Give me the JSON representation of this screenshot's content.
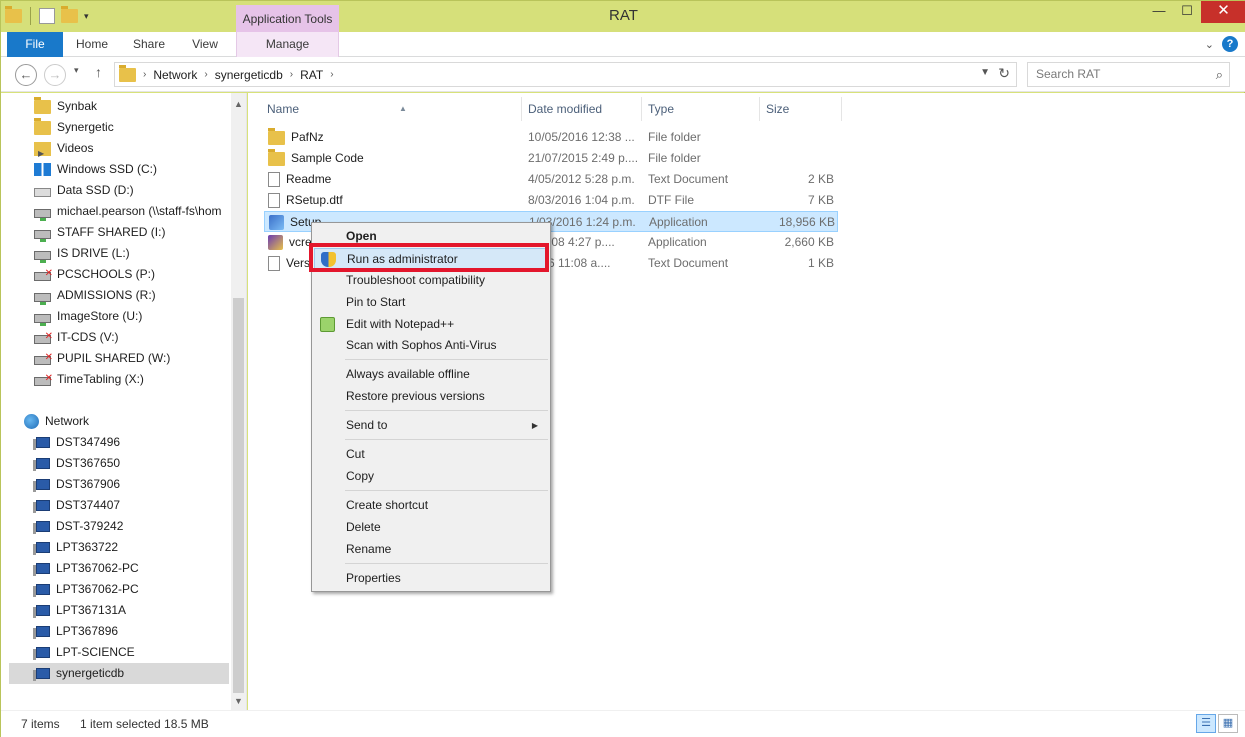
{
  "window": {
    "title": "RAT",
    "contextual_tab_group": "Application Tools",
    "controls": [
      "—",
      "☐",
      "✕"
    ]
  },
  "ribbon": {
    "tabs": [
      "File",
      "Home",
      "Share",
      "View",
      "Manage"
    ]
  },
  "address": {
    "breadcrumbs": [
      "Network",
      "synergeticdb",
      "RAT"
    ],
    "search_placeholder": "Search RAT"
  },
  "nav_pane": {
    "items": [
      {
        "label": "Synbak",
        "icon": "folder-icon"
      },
      {
        "label": "Synergetic",
        "icon": "folder-icon"
      },
      {
        "label": "Videos",
        "icon": "videos-icon"
      },
      {
        "label": "Windows SSD (C:)",
        "icon": "windows-drive-icon"
      },
      {
        "label": "Data SSD (D:)",
        "icon": "drive-icon"
      },
      {
        "label": "michael.pearson (\\\\staff-fs\\hom",
        "icon": "network-drive-icon"
      },
      {
        "label": "STAFF SHARED (I:)",
        "icon": "network-drive-icon"
      },
      {
        "label": "IS DRIVE (L:)",
        "icon": "network-drive-icon"
      },
      {
        "label": "PCSCHOOLS (P:)",
        "icon": "disconnected-drive-icon"
      },
      {
        "label": "ADMISSIONS (R:)",
        "icon": "network-drive-icon"
      },
      {
        "label": "ImageStore (U:)",
        "icon": "network-drive-icon"
      },
      {
        "label": "IT-CDS (V:)",
        "icon": "disconnected-drive-icon"
      },
      {
        "label": "PUPIL SHARED (W:)",
        "icon": "disconnected-drive-icon"
      },
      {
        "label": "TimeTabling (X:)",
        "icon": "disconnected-drive-icon"
      }
    ],
    "network_label": "Network",
    "computers": [
      "DST347496",
      "DST367650",
      "DST367906",
      "DST374407",
      "DST-379242",
      "LPT363722",
      "LPT367062-PC",
      "LPT367062-PC",
      "LPT367131A",
      "LPT367896",
      "LPT-SCIENCE",
      "synergeticdb"
    ]
  },
  "file_list": {
    "columns": [
      "Name",
      "Date modified",
      "Type",
      "Size"
    ],
    "rows": [
      {
        "name": "PafNz",
        "date": "10/05/2016 12:38 ...",
        "type": "File folder",
        "size": "",
        "icon": "folder-icon"
      },
      {
        "name": "Sample Code",
        "date": "21/07/2015 2:49 p....",
        "type": "File folder",
        "size": "",
        "icon": "folder-icon"
      },
      {
        "name": "Readme",
        "date": "4/05/2012 5:28 p.m.",
        "type": "Text Document",
        "size": "2 KB",
        "icon": "text-file-icon"
      },
      {
        "name": "RSetup.dtf",
        "date": "8/03/2016 1:04 p.m.",
        "type": "DTF File",
        "size": "7 KB",
        "icon": "file-icon"
      },
      {
        "name": "Setup",
        "date": "1/03/2016 1:24 p.m.",
        "type": "Application",
        "size": "18,956 KB",
        "icon": "setup-app-icon"
      },
      {
        "name": "vcre",
        "date": "1/2008 4:27 p....",
        "type": "Application",
        "size": "2,660 KB",
        "icon": "vcredist-icon"
      },
      {
        "name": "Vers",
        "date": "2016 11:08 a....",
        "type": "Text Document",
        "size": "1 KB",
        "icon": "text-file-icon"
      }
    ],
    "selected_row": 4
  },
  "context_menu": {
    "items": [
      "Open",
      "Run as administrator",
      "Troubleshoot compatibility",
      "Pin to Start",
      "Edit with Notepad++",
      "Scan with Sophos Anti-Virus",
      "Always available offline",
      "Restore previous versions",
      "Send to",
      "Cut",
      "Copy",
      "Create shortcut",
      "Delete",
      "Rename",
      "Properties"
    ],
    "highlighted": "Run as administrator"
  },
  "status_bar": {
    "item_count": "7 items",
    "selection": "1 item selected  18.5 MB"
  },
  "colors": {
    "accent": "#1979ca",
    "titlebar": "#d6e07a",
    "contextual_tab": "#e6c3e8",
    "highlight_box": "#e3162c",
    "selection": "#cce8ff"
  }
}
